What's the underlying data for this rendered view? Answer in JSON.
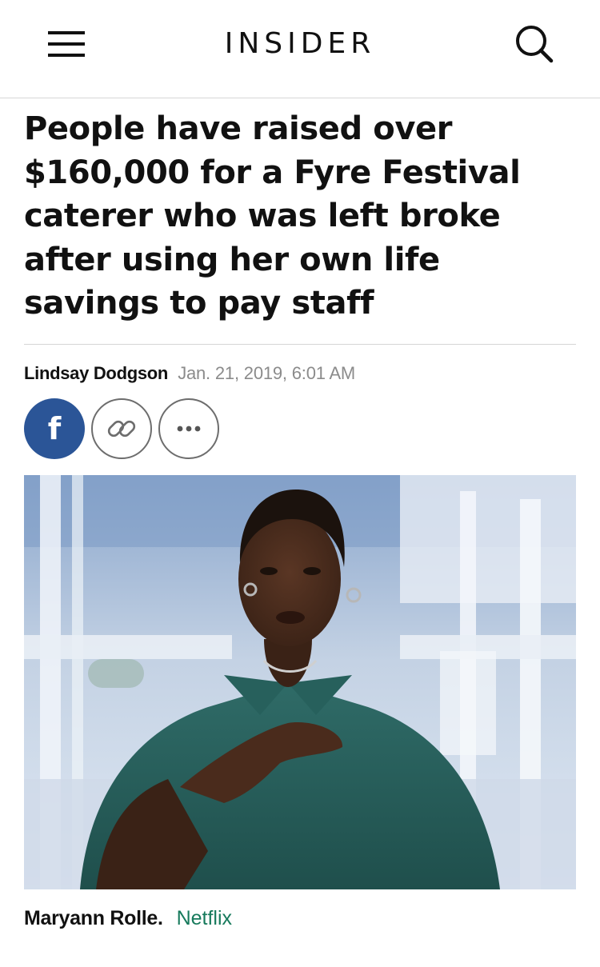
{
  "header": {
    "brand": "INSIDER",
    "menu_icon": "hamburger-menu-icon",
    "search_icon": "search-icon"
  },
  "article": {
    "headline": "People have raised over $160,000 for a Fyre Festival caterer who was left broke after using her own life savings to pay staff",
    "author": "Lindsay Dodgson",
    "date": "Jan. 21, 2019, 6:01 AM"
  },
  "share": {
    "facebook_glyph": "f",
    "facebook_icon": "facebook-icon",
    "link_icon": "link-icon",
    "more_icon": "more-dots-icon",
    "facebook_color": "#2b5597"
  },
  "image": {
    "caption_name": "Maryann Rolle.",
    "caption_credit": "Netflix"
  },
  "colors": {
    "credit_link": "#177a5c",
    "date_text": "#8b8b8b"
  }
}
